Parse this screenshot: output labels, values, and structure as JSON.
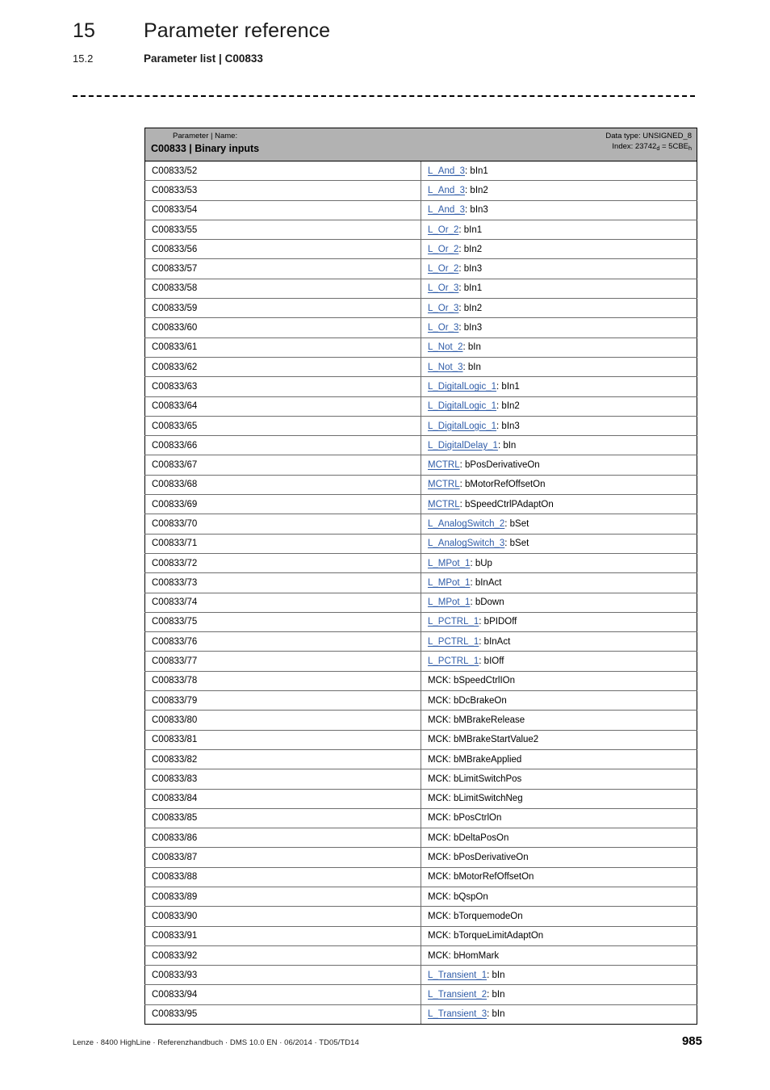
{
  "header": {
    "chapter_number": "15",
    "chapter_title": "Parameter reference",
    "section_number": "15.2",
    "section_title": "Parameter list | C00833"
  },
  "table": {
    "head": {
      "left_label": "Parameter | Name:",
      "left_value": "C00833 | Binary inputs",
      "right_label": "Data type: UNSIGNED_8",
      "right_value_prefix": "Index: 23742",
      "right_value_sub1": "d",
      "right_value_mid": " = 5CBE",
      "right_value_sub2": "h"
    },
    "rows": [
      {
        "code": "C00833/52",
        "link": "L_And_3",
        "rest": ": bIn1"
      },
      {
        "code": "C00833/53",
        "link": "L_And_3",
        "rest": ": bIn2"
      },
      {
        "code": "C00833/54",
        "link": "L_And_3",
        "rest": ": bIn3"
      },
      {
        "code": "C00833/55",
        "link": "L_Or_2",
        "rest": ": bIn1"
      },
      {
        "code": "C00833/56",
        "link": "L_Or_2",
        "rest": ": bIn2"
      },
      {
        "code": "C00833/57",
        "link": "L_Or_2",
        "rest": ": bIn3"
      },
      {
        "code": "C00833/58",
        "link": "L_Or_3",
        "rest": ": bIn1"
      },
      {
        "code": "C00833/59",
        "link": "L_Or_3",
        "rest": ": bIn2"
      },
      {
        "code": "C00833/60",
        "link": "L_Or_3",
        "rest": ": bIn3"
      },
      {
        "code": "C00833/61",
        "link": "L_Not_2",
        "rest": ": bIn"
      },
      {
        "code": "C00833/62",
        "link": "L_Not_3",
        "rest": ": bIn"
      },
      {
        "code": "C00833/63",
        "link": "L_DigitalLogic_1",
        "rest": ": bIn1"
      },
      {
        "code": "C00833/64",
        "link": "L_DigitalLogic_1",
        "rest": ": bIn2"
      },
      {
        "code": "C00833/65",
        "link": "L_DigitalLogic_1",
        "rest": ": bIn3"
      },
      {
        "code": "C00833/66",
        "link": "L_DigitalDelay_1",
        "rest": ": bIn"
      },
      {
        "code": "C00833/67",
        "link": "MCTRL",
        "rest": ": bPosDerivativeOn"
      },
      {
        "code": "C00833/68",
        "link": "MCTRL",
        "rest": ": bMotorRefOffsetOn"
      },
      {
        "code": "C00833/69",
        "link": "MCTRL",
        "rest": ": bSpeedCtrlPAdaptOn"
      },
      {
        "code": "C00833/70",
        "link": "L_AnalogSwitch_2",
        "rest": ": bSet"
      },
      {
        "code": "C00833/71",
        "link": "L_AnalogSwitch_3",
        "rest": ": bSet"
      },
      {
        "code": "C00833/72",
        "link": "L_MPot_1",
        "rest": ": bUp"
      },
      {
        "code": "C00833/73",
        "link": "L_MPot_1",
        "rest": ": bInAct"
      },
      {
        "code": "C00833/74",
        "link": "L_MPot_1",
        "rest": ": bDown"
      },
      {
        "code": "C00833/75",
        "link": "L_PCTRL_1",
        "rest": ": bPIDOff"
      },
      {
        "code": "C00833/76",
        "link": "L_PCTRL_1",
        "rest": ": bInAct"
      },
      {
        "code": "C00833/77",
        "link": "L_PCTRL_1",
        "rest": ": bIOff"
      },
      {
        "code": "C00833/78",
        "link": "",
        "rest": "MCK: bSpeedCtrlIOn"
      },
      {
        "code": "C00833/79",
        "link": "",
        "rest": "MCK: bDcBrakeOn"
      },
      {
        "code": "C00833/80",
        "link": "",
        "rest": "MCK: bMBrakeRelease"
      },
      {
        "code": "C00833/81",
        "link": "",
        "rest": "MCK: bMBrakeStartValue2"
      },
      {
        "code": "C00833/82",
        "link": "",
        "rest": "MCK: bMBrakeApplied"
      },
      {
        "code": "C00833/83",
        "link": "",
        "rest": "MCK: bLimitSwitchPos"
      },
      {
        "code": "C00833/84",
        "link": "",
        "rest": "MCK: bLimitSwitchNeg"
      },
      {
        "code": "C00833/85",
        "link": "",
        "rest": "MCK: bPosCtrlOn"
      },
      {
        "code": "C00833/86",
        "link": "",
        "rest": "MCK: bDeltaPosOn"
      },
      {
        "code": "C00833/87",
        "link": "",
        "rest": "MCK: bPosDerivativeOn"
      },
      {
        "code": "C00833/88",
        "link": "",
        "rest": "MCK: bMotorRefOffsetOn"
      },
      {
        "code": "C00833/89",
        "link": "",
        "rest": "MCK: bQspOn"
      },
      {
        "code": "C00833/90",
        "link": "",
        "rest": "MCK: bTorquemodeOn"
      },
      {
        "code": "C00833/91",
        "link": "",
        "rest": "MCK: bTorqueLimitAdaptOn"
      },
      {
        "code": "C00833/92",
        "link": "",
        "rest": "MCK: bHomMark"
      },
      {
        "code": "C00833/93",
        "link": "L_Transient_1",
        "rest": ": bIn"
      },
      {
        "code": "C00833/94",
        "link": "L_Transient_2",
        "rest": ": bIn"
      },
      {
        "code": "C00833/95",
        "link": "L_Transient_3",
        "rest": ": bIn"
      }
    ]
  },
  "footer": {
    "left": "Lenze · 8400 HighLine · Referenzhandbuch · DMS 10.0 EN · 06/2014 · TD05/TD14",
    "page_number": "985"
  },
  "colors": {
    "link": "#2f5ca8",
    "header_bg": "#b2b2b2",
    "rule": "#6e6e6e"
  }
}
